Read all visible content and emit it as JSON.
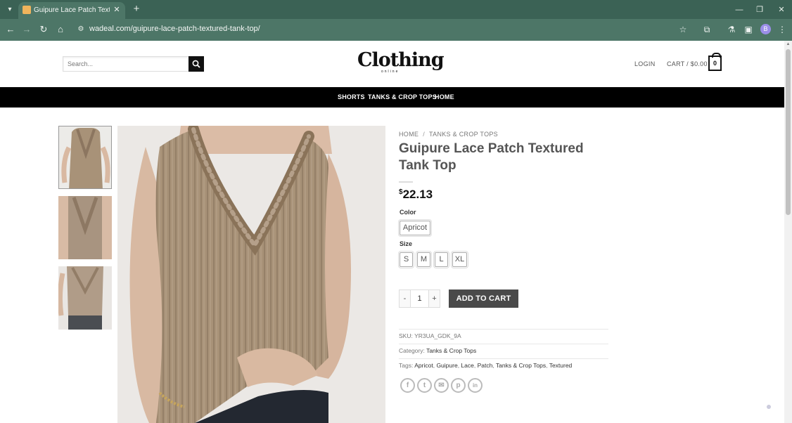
{
  "browser": {
    "tab_title": "Guipure Lace Patch Textured Ta",
    "url": "wadeal.com/guipure-lace-patch-textured-tank-top/",
    "profile_initial": "B",
    "icons": {
      "tab_list": "▾",
      "close": "✕",
      "new_tab": "+",
      "minimize": "—",
      "restore": "❐",
      "window_close": "✕",
      "back": "←",
      "forward": "→",
      "reload": "↻",
      "home": "⌂",
      "site_info": "⚙",
      "star": "☆",
      "extensions": "⧉",
      "labs": "⚗",
      "side_panel": "▣",
      "menu": "⋮"
    }
  },
  "header": {
    "search_placeholder": "Search...",
    "logo_main": "Clothing",
    "logo_sub": "online",
    "login": "LOGIN",
    "cart": "CART / $0.00",
    "cart_count": "0"
  },
  "nav": {
    "items": [
      "SHORTS",
      "TANKS & CROP TOPS",
      "HOME"
    ]
  },
  "product": {
    "breadcrumb": [
      "HOME",
      "TANKS & CROP TOPS"
    ],
    "breadcrumb_sep": "/",
    "title": "Guipure Lace Patch Textured Tank Top",
    "currency_symbol": "$",
    "price": "22.13",
    "color_label": "Color",
    "colors": [
      "Apricot"
    ],
    "size_label": "Size",
    "sizes": [
      "S",
      "M",
      "L",
      "XL"
    ],
    "qty_minus": "-",
    "qty_value": "1",
    "qty_plus": "+",
    "add_to_cart": "ADD TO CART",
    "sku_label": "SKU:",
    "sku": "YR3UA_GDK_9A",
    "category_label": "Category:",
    "category": "Tanks & Crop Tops",
    "tags_label": "Tags:",
    "tags": [
      "Apricot",
      "Guipure",
      "Lace",
      "Patch",
      "Tanks & Crop Tops",
      "Textured"
    ]
  },
  "share": {
    "icons": [
      "facebook-icon",
      "twitter-icon",
      "email-icon",
      "pinterest-icon",
      "linkedin-icon"
    ],
    "glyphs": [
      "f",
      "t",
      "✉",
      "p",
      "in"
    ]
  },
  "colors": {
    "chrome_bg": "#3b6255",
    "toolbar_bg": "#4d7667",
    "nav_bg": "#000000",
    "button_bg": "#4a4a4a",
    "fabric": "#a89278"
  }
}
